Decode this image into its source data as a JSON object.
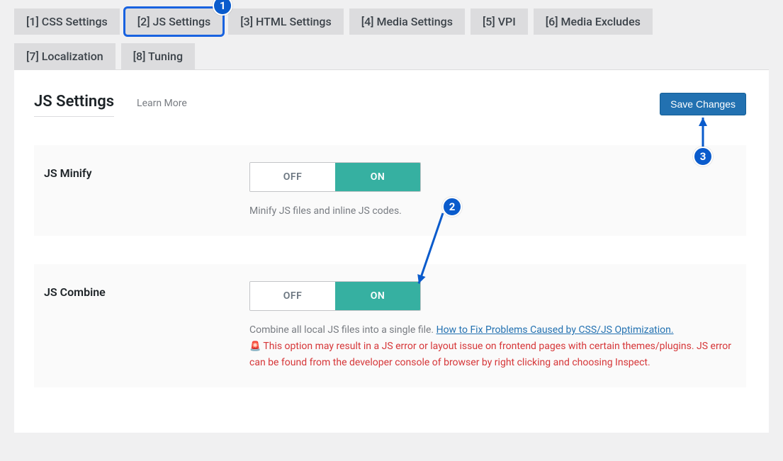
{
  "tabs": {
    "row1": [
      {
        "label": "[1] CSS Settings"
      },
      {
        "label": "[2] JS Settings"
      },
      {
        "label": "[3] HTML Settings"
      },
      {
        "label": "[4] Media Settings"
      },
      {
        "label": "[5] VPI"
      },
      {
        "label": "[6] Media Excludes"
      }
    ],
    "row2": [
      {
        "label": "[7] Localization"
      },
      {
        "label": "[8] Tuning"
      }
    ],
    "active_label": "[2] JS Settings"
  },
  "header": {
    "title": "JS Settings",
    "learn_more": "Learn More",
    "save_button": "Save Changes"
  },
  "toggle": {
    "off": "OFF",
    "on": "ON"
  },
  "settings": {
    "js_minify": {
      "label": "JS Minify",
      "value": "ON",
      "desc": "Minify JS files and inline JS codes."
    },
    "js_combine": {
      "label": "JS Combine",
      "value": "ON",
      "desc_prefix": "Combine all local JS files into a single file. ",
      "link_text": "How to Fix Problems Caused by CSS/JS Optimization.",
      "warn_icon": "🚨",
      "warn_text": " This option may result in a JS error or layout issue on frontend pages with certain themes/plugins. JS error can be found from the developer console of browser by right clicking and choosing Inspect."
    }
  },
  "annotations": {
    "b1": "1",
    "b2": "2",
    "b3": "3"
  }
}
